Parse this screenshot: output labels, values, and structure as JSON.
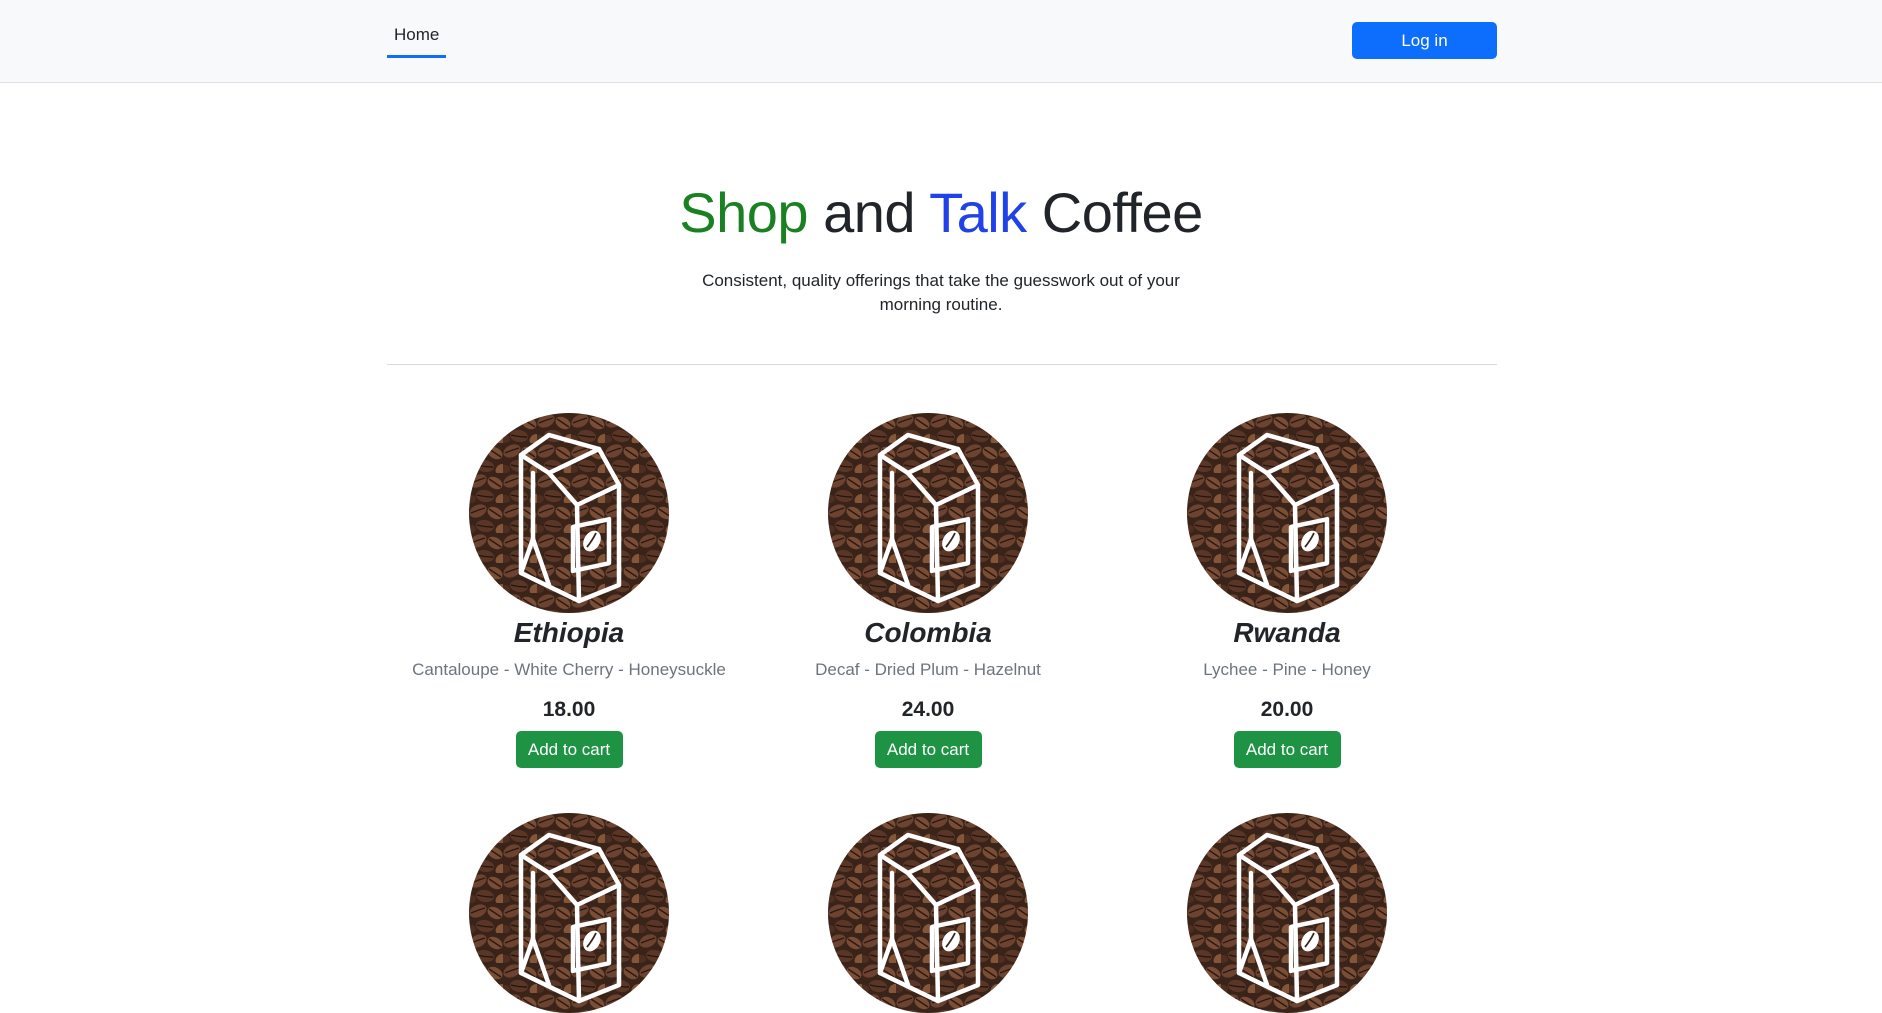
{
  "nav": {
    "home_label": "Home",
    "login_label": "Log in"
  },
  "hero": {
    "title_words": [
      "Shop",
      "and",
      "Talk",
      "Coffee"
    ],
    "subtitle": "Consistent, quality offerings that take the guesswork out of your morning routine."
  },
  "colors": {
    "primary": "#0d6efd",
    "success": "#1f9344",
    "shop_green": "#198122",
    "talk_blue": "#1f43e8",
    "muted": "#6c757d"
  },
  "products": [
    {
      "name": "Ethiopia",
      "notes": "Cantaloupe - White Cherry - Honeysuckle",
      "price": "18.00",
      "cart_label": "Add to cart",
      "icon": "coffee-bag-icon"
    },
    {
      "name": "Colombia",
      "notes": "Decaf - Dried Plum - Hazelnut",
      "price": "24.00",
      "cart_label": "Add to cart",
      "icon": "coffee-bag-icon"
    },
    {
      "name": "Rwanda",
      "notes": "Lychee - Pine - Honey",
      "price": "20.00",
      "cart_label": "Add to cart",
      "icon": "coffee-bag-icon"
    },
    {
      "name": "",
      "notes": "",
      "price": "",
      "cart_label": "",
      "icon": "coffee-bag-icon"
    },
    {
      "name": "",
      "notes": "",
      "price": "",
      "cart_label": "",
      "icon": "coffee-bag-icon"
    },
    {
      "name": "",
      "notes": "",
      "price": "",
      "cart_label": "",
      "icon": "coffee-bag-icon"
    }
  ]
}
